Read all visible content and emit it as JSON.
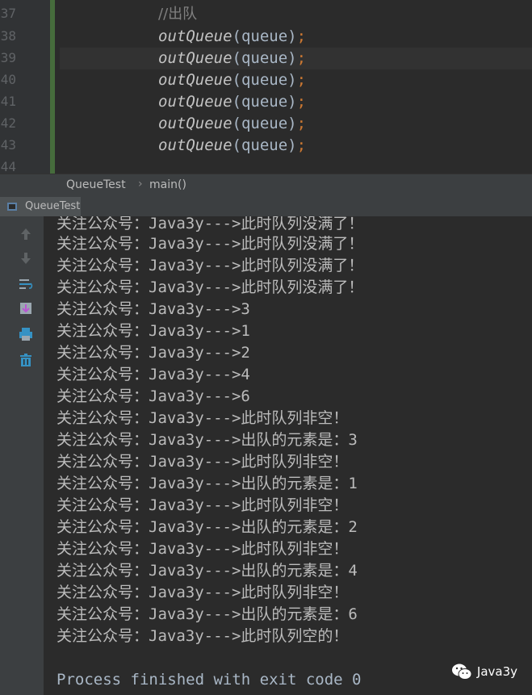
{
  "editor": {
    "line_numbers": [
      "37",
      "38",
      "39",
      "40",
      "41",
      "42",
      "43",
      "44"
    ],
    "comment": "//出队",
    "call_fn": "outQueue",
    "call_arg": "(queue)",
    "call_semi": ";",
    "call_count": 6
  },
  "breadcrumb": {
    "class_name": "QueueTest",
    "method_name": "main()"
  },
  "run_panel": {
    "tab_label": "QueueTest",
    "toolbar_icons": [
      "up-arrow-icon",
      "down-arrow-icon",
      "soft-wrap-icon",
      "scroll-to-end-icon",
      "print-icon",
      "trash-icon"
    ]
  },
  "console": {
    "lines": [
      "关注公众号：Java3y--->此时队列没满了！",
      "关注公众号：Java3y--->此时队列没满了！",
      "关注公众号：Java3y--->此时队列没满了！",
      "关注公众号：Java3y--->此时队列没满了！",
      "关注公众号：Java3y--->3",
      "关注公众号：Java3y--->1",
      "关注公众号：Java3y--->2",
      "关注公众号：Java3y--->4",
      "关注公众号：Java3y--->6",
      "关注公众号：Java3y--->此时队列非空！",
      "关注公众号：Java3y--->出队的元素是：3",
      "关注公众号：Java3y--->此时队列非空！",
      "关注公众号：Java3y--->出队的元素是：1",
      "关注公众号：Java3y--->此时队列非空！",
      "关注公众号：Java3y--->出队的元素是：2",
      "关注公众号：Java3y--->此时队列非空！",
      "关注公众号：Java3y--->出队的元素是：4",
      "关注公众号：Java3y--->此时队列非空！",
      "关注公众号：Java3y--->出队的元素是：6",
      "关注公众号：Java3y--->此时队列空的！"
    ],
    "process_text": "Process finished with exit code 0"
  },
  "watermark": {
    "text": "Java3y",
    "icon": "wechat-icon"
  }
}
